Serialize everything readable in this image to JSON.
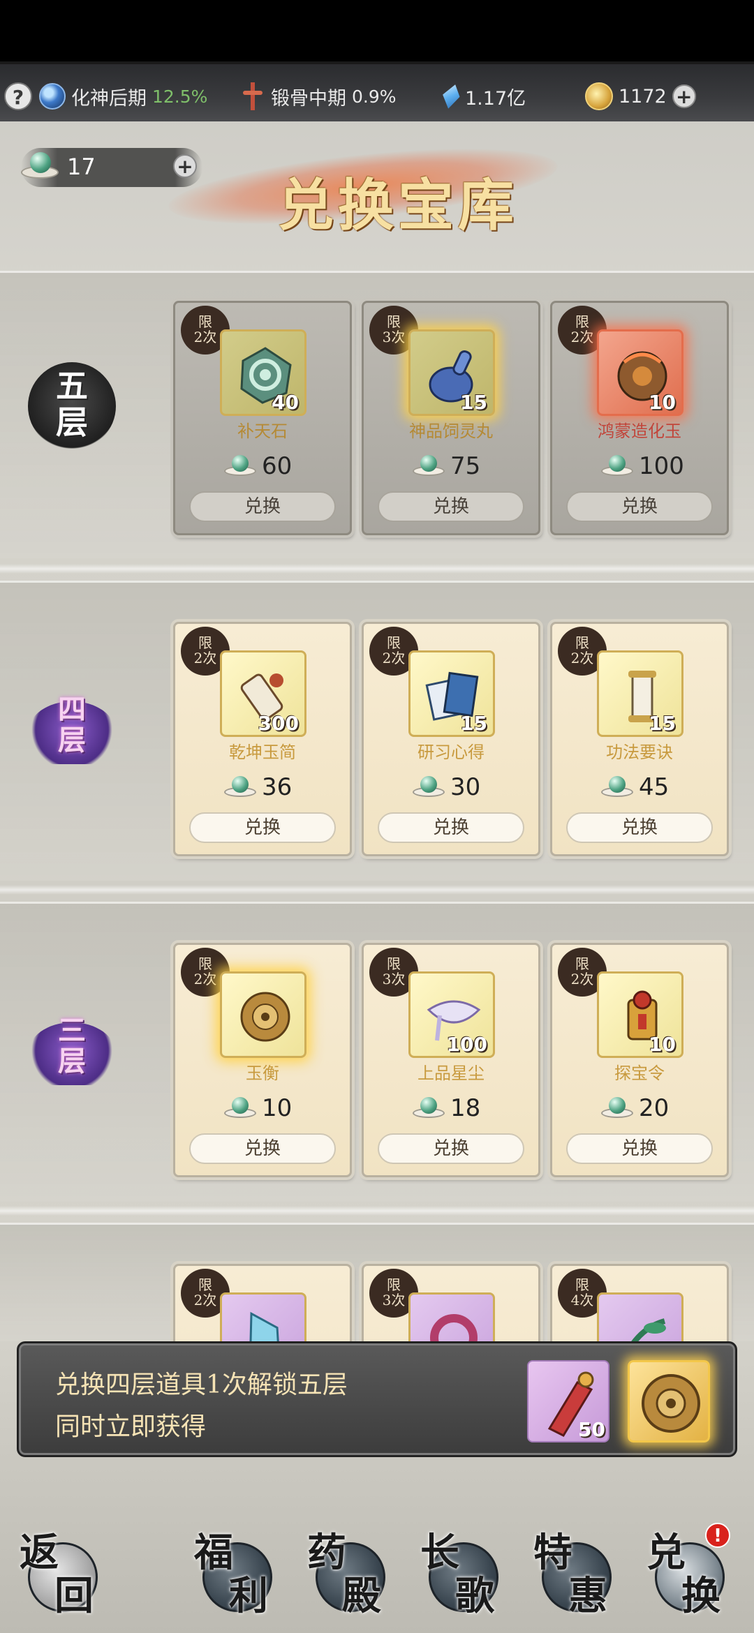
{
  "status_bar": {
    "help_label": "?",
    "realm": {
      "label": "化神后期",
      "percent": "12.5%"
    },
    "body": {
      "label": "锻骨中期",
      "percent": "0.9%"
    },
    "spirit_stones": "1.17亿",
    "coins": "1172"
  },
  "jade": {
    "count": "17",
    "plus": "+"
  },
  "title": "兑换宝库",
  "tiers": [
    {
      "label_1": "五",
      "label_2": "层",
      "style": "dark",
      "items": [
        {
          "limit_1": "限",
          "limit_2": "2次",
          "qty": "40",
          "name": "补天石",
          "price": "60",
          "button": "兑换"
        },
        {
          "limit_1": "限",
          "limit_2": "3次",
          "qty": "15",
          "name": "神品饲灵丸",
          "price": "75",
          "button": "兑换"
        },
        {
          "limit_1": "限",
          "limit_2": "2次",
          "qty": "10",
          "name": "鸿蒙造化玉",
          "price": "100",
          "button": "兑换"
        }
      ]
    },
    {
      "label_1": "四",
      "label_2": "层",
      "style": "purple",
      "items": [
        {
          "limit_1": "限",
          "limit_2": "2次",
          "qty": "300",
          "name": "乾坤玉简",
          "price": "36",
          "button": "兑换"
        },
        {
          "limit_1": "限",
          "limit_2": "2次",
          "qty": "15",
          "name": "研习心得",
          "price": "30",
          "button": "兑换"
        },
        {
          "limit_1": "限",
          "limit_2": "2次",
          "qty": "15",
          "name": "功法要诀",
          "price": "45",
          "button": "兑换"
        }
      ]
    },
    {
      "label_1": "三",
      "label_2": "层",
      "style": "purple",
      "items": [
        {
          "limit_1": "限",
          "limit_2": "2次",
          "qty": "",
          "name": "玉衡",
          "price": "10",
          "button": "兑换"
        },
        {
          "limit_1": "限",
          "limit_2": "3次",
          "qty": "100",
          "name": "上品星尘",
          "price": "18",
          "button": "兑换"
        },
        {
          "limit_1": "限",
          "limit_2": "2次",
          "qty": "10",
          "name": "探宝令",
          "price": "20",
          "button": "兑换"
        }
      ]
    },
    {
      "items": [
        {
          "limit_1": "限",
          "limit_2": "2次"
        },
        {
          "limit_1": "限",
          "limit_2": "3次"
        },
        {
          "limit_1": "限",
          "limit_2": "4次"
        }
      ]
    }
  ],
  "banner": {
    "line1": "兑换四层道具1次解锁五层",
    "line2": "同时立即获得",
    "reward_qty": "50"
  },
  "nav": [
    {
      "c1": "返",
      "c2": "回",
      "id": "back"
    },
    {
      "c1": "福",
      "c2": "利",
      "id": "welfare"
    },
    {
      "c1": "药",
      "c2": "殿",
      "id": "medicine-hall"
    },
    {
      "c1": "长",
      "c2": "歌",
      "id": "changge"
    },
    {
      "c1": "特",
      "c2": "惠",
      "id": "special-offer"
    },
    {
      "c1": "兑",
      "c2": "换",
      "id": "exchange",
      "alert": "!"
    }
  ]
}
